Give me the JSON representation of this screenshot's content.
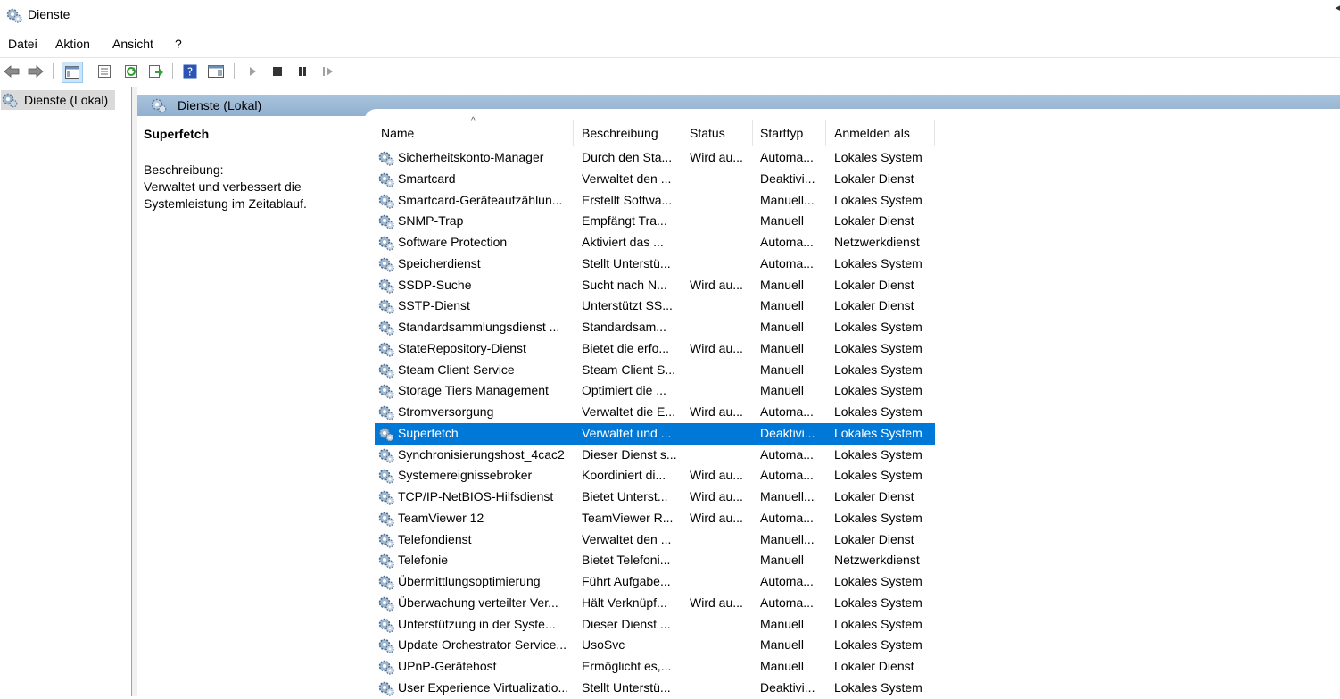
{
  "window": {
    "title": "Dienste",
    "corner_glyph": "◂"
  },
  "menu": [
    "Datei",
    "Aktion",
    "Ansicht",
    "?"
  ],
  "toolbar": [
    "back-icon",
    "forward-icon",
    "console-tree-icon",
    "properties-icon",
    "refresh-icon",
    "export-list-icon",
    "help-icon",
    "action-pane-icon",
    "start-service-icon",
    "stop-service-icon",
    "pause-service-icon",
    "resume-service-icon"
  ],
  "tree": {
    "root_label": "Dienste (Lokal)"
  },
  "panel": {
    "title": "Dienste (Lokal)"
  },
  "details": {
    "title": "Superfetch",
    "label": "Beschreibung:",
    "text_line1": "Verwaltet und verbessert die",
    "text_line2": "Systemleistung im Zeitablauf."
  },
  "columns": [
    "Name",
    "Beschreibung",
    "Status",
    "Starttyp",
    "Anmelden als"
  ],
  "selected_color": "#0078d7",
  "rows": [
    [
      "Sicherheitskonto-Manager",
      "Durch den Sta...",
      "Wird au...",
      "Automa...",
      "Lokales System"
    ],
    [
      "Smartcard",
      "Verwaltet den ...",
      "",
      "Deaktivi...",
      "Lokaler Dienst"
    ],
    [
      "Smartcard-Geräteaufzählun...",
      "Erstellt Softwa...",
      "",
      "Manuell...",
      "Lokales System"
    ],
    [
      "SNMP-Trap",
      "Empfängt Tra...",
      "",
      "Manuell",
      "Lokaler Dienst"
    ],
    [
      "Software Protection",
      "Aktiviert das ...",
      "",
      "Automa...",
      "Netzwerkdienst"
    ],
    [
      "Speicherdienst",
      "Stellt Unterstü...",
      "",
      "Automa...",
      "Lokales System"
    ],
    [
      "SSDP-Suche",
      "Sucht nach N...",
      "Wird au...",
      "Manuell",
      "Lokaler Dienst"
    ],
    [
      "SSTP-Dienst",
      "Unterstützt SS...",
      "",
      "Manuell",
      "Lokaler Dienst"
    ],
    [
      "Standardsammlungsdienst ...",
      "Standardsam...",
      "",
      "Manuell",
      "Lokales System"
    ],
    [
      "StateRepository-Dienst",
      "Bietet die erfo...",
      "Wird au...",
      "Manuell",
      "Lokales System"
    ],
    [
      "Steam Client Service",
      "Steam Client S...",
      "",
      "Manuell",
      "Lokales System"
    ],
    [
      "Storage Tiers Management",
      "Optimiert die ...",
      "",
      "Manuell",
      "Lokales System"
    ],
    [
      "Stromversorgung",
      "Verwaltet die E...",
      "Wird au...",
      "Automa...",
      "Lokales System"
    ],
    [
      "Superfetch",
      "Verwaltet und ...",
      "",
      "Deaktivi...",
      "Lokales System"
    ],
    [
      "Synchronisierungshost_4cac2",
      "Dieser Dienst s...",
      "",
      "Automa...",
      "Lokales System"
    ],
    [
      "Systemereignissebroker",
      "Koordiniert di...",
      "Wird au...",
      "Automa...",
      "Lokales System"
    ],
    [
      "TCP/IP-NetBIOS-Hilfsdienst",
      "Bietet Unterst...",
      "Wird au...",
      "Manuell...",
      "Lokaler Dienst"
    ],
    [
      "TeamViewer 12",
      "TeamViewer R...",
      "Wird au...",
      "Automa...",
      "Lokales System"
    ],
    [
      "Telefondienst",
      "Verwaltet den ...",
      "",
      "Manuell...",
      "Lokaler Dienst"
    ],
    [
      "Telefonie",
      "Bietet Telefoni...",
      "",
      "Manuell",
      "Netzwerkdienst"
    ],
    [
      "Übermittlungsoptimierung",
      "Führt Aufgabe...",
      "",
      "Automa...",
      "Lokales System"
    ],
    [
      "Überwachung verteilter Ver...",
      "Hält Verknüpf...",
      "Wird au...",
      "Automa...",
      "Lokales System"
    ],
    [
      "Unterstützung in der Syste...",
      "Dieser Dienst ...",
      "",
      "Manuell",
      "Lokales System"
    ],
    [
      "Update Orchestrator Service...",
      "UsoSvc",
      "",
      "Manuell",
      "Lokales System"
    ],
    [
      "UPnP-Gerätehost",
      "Ermöglicht es,...",
      "",
      "Manuell",
      "Lokaler Dienst"
    ],
    [
      "User Experience Virtualizatio...",
      "Stellt Unterstü...",
      "",
      "Deaktivi...",
      "Lokales System"
    ]
  ],
  "selected_index": 13
}
